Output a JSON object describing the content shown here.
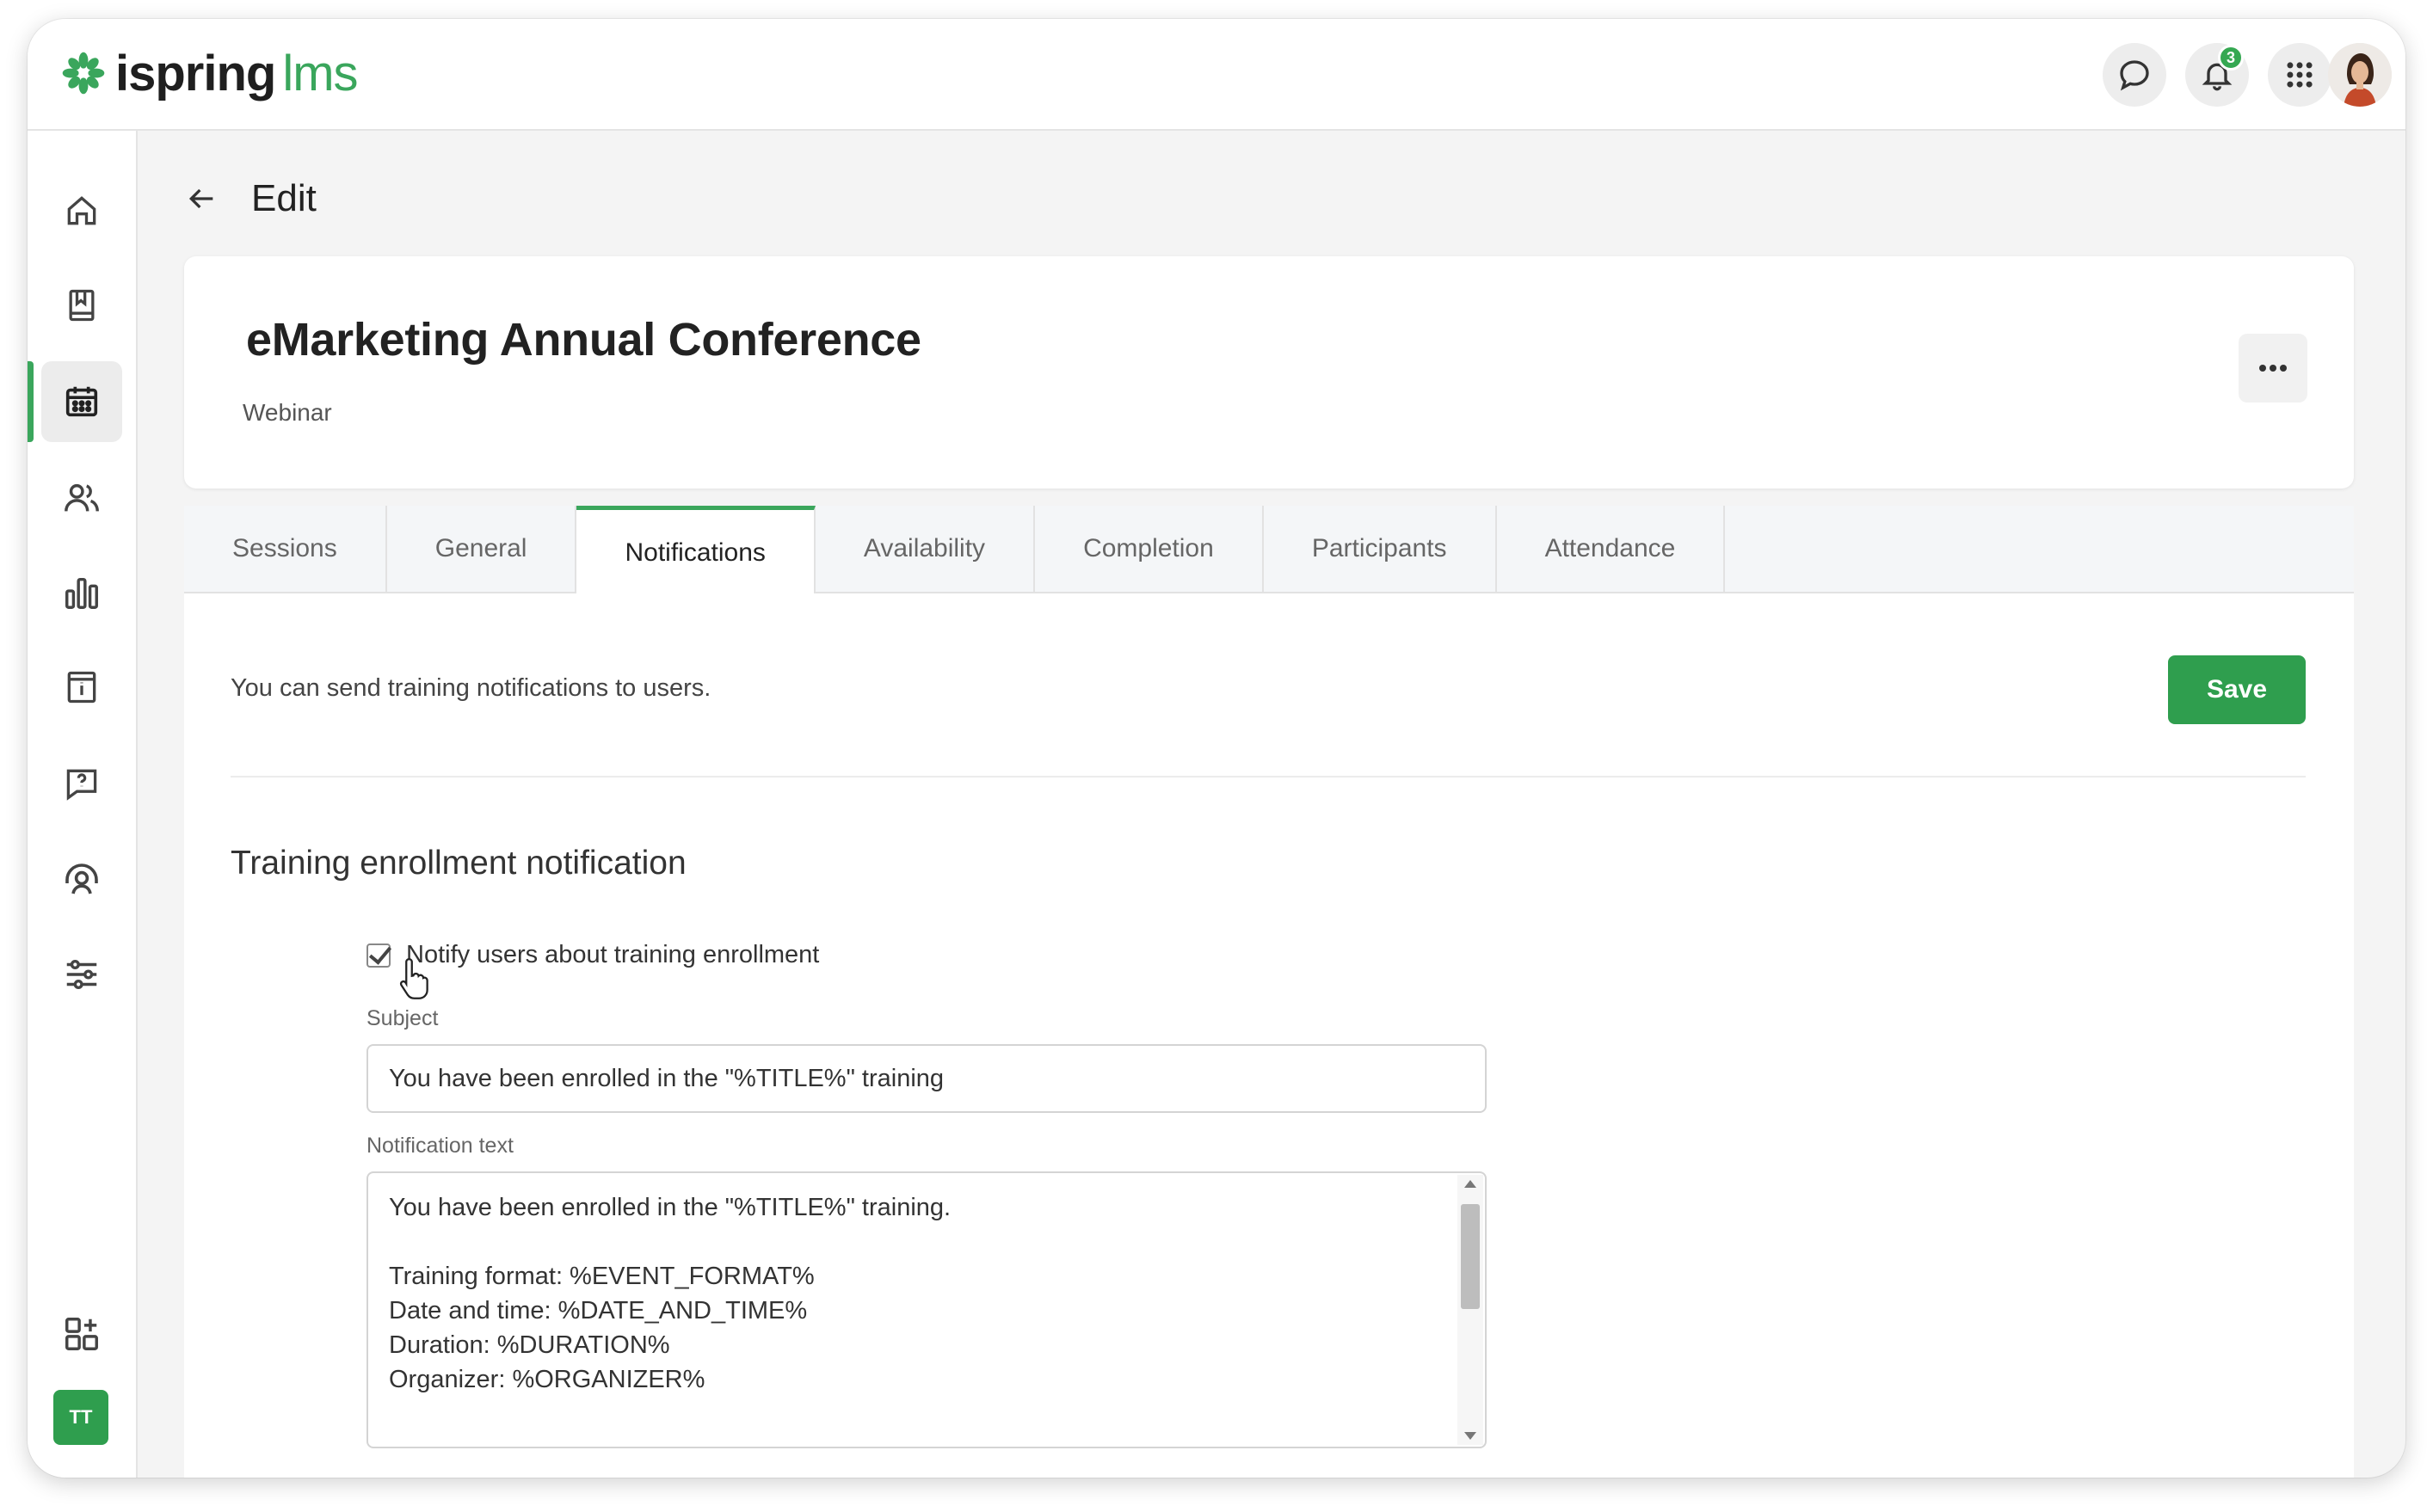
{
  "brand": {
    "word1": "ispring",
    "word2": "lms",
    "color": "#3aa65c"
  },
  "topbar": {
    "chat_icon": "chat-bubble-icon",
    "notifications_icon": "bell-icon",
    "notifications_count": "3",
    "apps_icon": "grid-icon",
    "avatar": "user-avatar"
  },
  "sidebar": {
    "items": [
      {
        "name": "home",
        "icon": "home-icon"
      },
      {
        "name": "courses",
        "icon": "book-icon"
      },
      {
        "name": "calendar",
        "icon": "calendar-icon",
        "active": true
      },
      {
        "name": "users",
        "icon": "users-icon"
      },
      {
        "name": "reports",
        "icon": "bar-chart-icon"
      },
      {
        "name": "info",
        "icon": "info-icon"
      },
      {
        "name": "help",
        "icon": "question-icon"
      },
      {
        "name": "support",
        "icon": "headset-icon"
      },
      {
        "name": "settings",
        "icon": "sliders-icon"
      },
      {
        "name": "apps",
        "icon": "add-apps-icon"
      }
    ],
    "account_initials": "TT"
  },
  "header": {
    "title": "Edit"
  },
  "event": {
    "title": "eMarketing Annual Conference",
    "type": "Webinar"
  },
  "tabs": [
    {
      "label": "Sessions"
    },
    {
      "label": "General"
    },
    {
      "label": "Notifications",
      "active": true
    },
    {
      "label": "Availability"
    },
    {
      "label": "Completion"
    },
    {
      "label": "Participants"
    },
    {
      "label": "Attendance"
    }
  ],
  "notifications": {
    "info": "You can send training notifications to users.",
    "save_label": "Save",
    "section_title": "Training enrollment notification",
    "checkbox_label": "Notify users about training enrollment",
    "checkbox_checked": true,
    "subject_label": "Subject",
    "subject_value": "You have been enrolled in the \"%TITLE%\" training",
    "text_label": "Notification text",
    "text_lines": [
      "You have been enrolled in the \"%TITLE%\" training.",
      "",
      "Training format: %EVENT_FORMAT%",
      "Date and time: %DATE_AND_TIME%",
      "Duration: %DURATION%",
      "Organizer: %ORGANIZER%"
    ]
  }
}
